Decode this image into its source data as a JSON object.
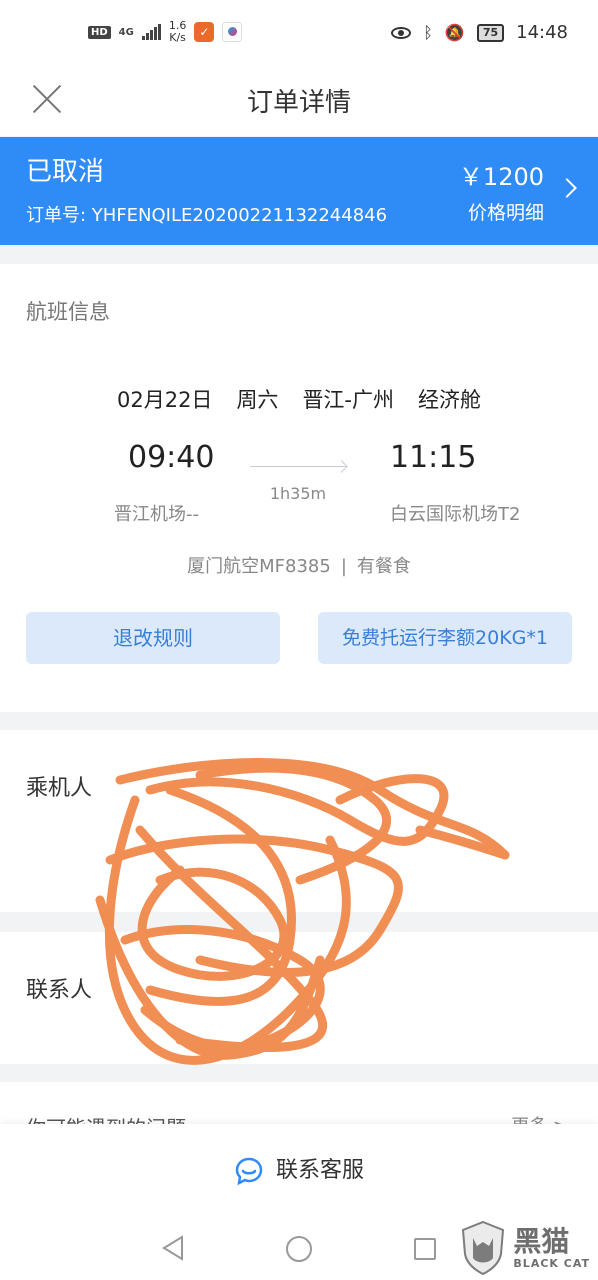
{
  "status_bar": {
    "hd": "HD",
    "signal": "4G",
    "speed_value": "1.6",
    "speed_unit": "K/s",
    "battery": "75",
    "time": "14:48"
  },
  "header": {
    "title": "订单详情"
  },
  "order": {
    "status": "已取消",
    "order_no_label": "订单号: YHFENQILE20200221132244846",
    "price": "￥1200",
    "price_detail_label": "价格明细",
    "accent_color": "#2f8bf5"
  },
  "flight": {
    "section_title": "航班信息",
    "date": "02月22日",
    "weekday": "周六",
    "route": "晋江-广州",
    "cabin": "经济舱",
    "dep_time": "09:40",
    "arr_time": "11:15",
    "duration": "1h35m",
    "dep_airport": "晋江机场--",
    "arr_airport": "白云国际机场T2",
    "airline": "厦门航空MF8385",
    "separator": "|",
    "meal": "有餐食",
    "rules_button": "退改规则",
    "baggage_button": "免费托运行李额20KG*1"
  },
  "passenger": {
    "label": "乘机人"
  },
  "contact": {
    "label": "联系人"
  },
  "issues": {
    "title": "你可能遇到的问题",
    "more": "更多 >"
  },
  "service": {
    "label": "联系客服"
  },
  "watermark": {
    "cn": "黑猫",
    "en": "BLACK CAT"
  }
}
